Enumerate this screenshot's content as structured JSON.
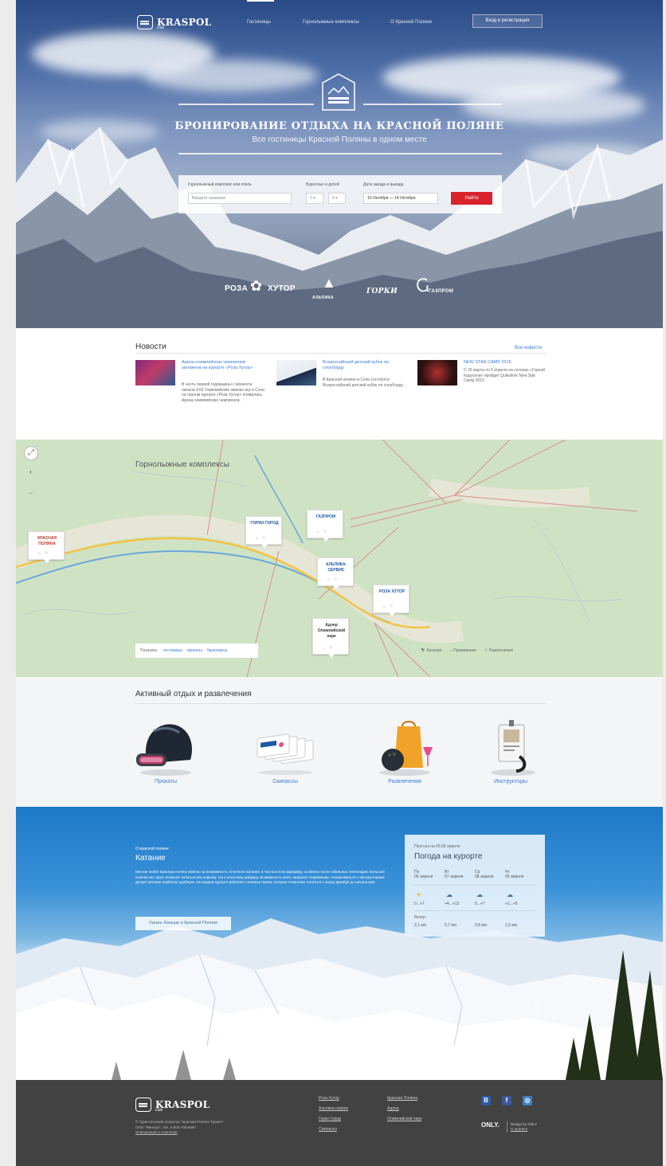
{
  "brand": {
    "name": "KRASPOL",
    "sub": "club"
  },
  "nav": {
    "items": [
      "Гостиницы",
      "Горнолыжные комплексы",
      "О Красной Поляне"
    ],
    "login": "Вход и регистрация"
  },
  "hero": {
    "title": "БРОНИРОВАНИЕ ОТДЫХА НА КРАСНОЙ ПОЛЯНЕ",
    "subtitle": "Все гостиницы Красной Поляны в одном месте"
  },
  "search": {
    "complex_label": "Горнолыжный комплекс или отель",
    "complex_placeholder": "Введите название",
    "guests_label": "Взрослых и детей",
    "adults": "2",
    "children": "0",
    "dates_label": "Дата заезда и выезда",
    "dates_value": "10 Октября — 14 Октября",
    "submit": "Найти"
  },
  "partners": [
    "РОЗА",
    "ХУТОР",
    "АЛЬПИКА",
    "ГОРКИ",
    "ГАЗПРОМ"
  ],
  "news": {
    "title": "Новости",
    "all": "Все новости",
    "items": [
      {
        "head": "Арена олимпийских чемпионов заложена на курорте «Роза Хутор»",
        "body": "В честь первой годовщины с момента начала XXII Олимпийских зимних игр в Сочи на горном курорте «Роза Хутор» появилась Арена олимпийских чемпионов."
      },
      {
        "head": "Всероссийский детский кубок по сноуборду",
        "body": "В Красной поляне в Сочи состоится Всероссийский детский кубок по сноуборду."
      },
      {
        "head": "NEW STAR CAMP 2015",
        "body": "С 20 марта по 5 апреля на склонах «Горной Карусели» пройдет Quiksilver New Star Camp 2015"
      }
    ]
  },
  "map": {
    "title": "Горнолыжные комплексы",
    "markers": [
      "КРАСНАЯ ПОЛЯНА",
      "ГОРКИ ГОРОД",
      "ГАЗПРОМ",
      "АЛЬПИКА-СЕРВИС",
      "РОЗА ХУТОР",
      "Адлер Олимпийский парк"
    ],
    "marker_icons": "⌂ ⚐",
    "filter_label": "Показать:",
    "filters": [
      "гостиницы",
      "прокаты",
      "банкоматы"
    ],
    "legend": [
      "Катание",
      "Проживание",
      "Развлечения"
    ]
  },
  "active": {
    "title": "Активный отдых и развлечения",
    "items": [
      "Прокаты",
      "Скипассы",
      "Развлечения",
      "Инструкторы"
    ]
  },
  "ski": {
    "small": "О красной поляне",
    "title": "Катание",
    "text": "Многие любят Красную поляну именно за возможность отличного катания, в частности во фрирайд, особенно после обильных снегопадов. Большое количество трасс позволит кататься как новичку, так и опытному райдеру. Возможность взять напрокат снаряжение, познакомиться с инструкторами делает катание наиболее удобным. На каждом курорте работают снежные пушки, которые позволяют кататься с конца декабря до начала мая.",
    "button": "Узнать больше о Красной Поляне",
    "arrow_left": "‹",
    "arrow_right": "›"
  },
  "weather": {
    "small": "Прогноз на 05.09 апреля",
    "title": "Погода на курорте",
    "days": [
      {
        "d": "Пн",
        "date": "06 апреля",
        "icon": "☀",
        "t": "0...+7"
      },
      {
        "d": "Вт",
        "date": "07 апреля",
        "icon": "☁",
        "t": "+4...+12"
      },
      {
        "d": "Ср",
        "date": "08 апреля",
        "icon": "☁",
        "t": "0...+7"
      },
      {
        "d": "Чт",
        "date": "09 апреля",
        "icon": "☁",
        "t": "+1...+5"
      }
    ],
    "wind_label": "Ветер:",
    "winds": [
      "2,1 м/с",
      "0,7 м/с",
      "0,8 м/с",
      "1,5 м/с"
    ]
  },
  "footer": {
    "info": [
      "© Туристический оператор \"Красная Поляна Тревел\"",
      "ООО \"Фингарт\", тел. 8-800-700-8687",
      "Информация о компании"
    ],
    "links_col1": [
      "Роза Хутор",
      "Альпика-сервис",
      "Горки Город",
      "Скипассы"
    ],
    "links_col2": [
      "Красная Поляна",
      "Адлер",
      "Олимпийский парк"
    ],
    "social": [
      "В",
      "f",
      "◎"
    ],
    "only": "ONLY.",
    "design_by": [
      "Design by ONLY",
      "О проекте"
    ]
  },
  "colors": {
    "accent": "#3a7bd5",
    "button": "#d7242c",
    "footer": "#424242"
  }
}
